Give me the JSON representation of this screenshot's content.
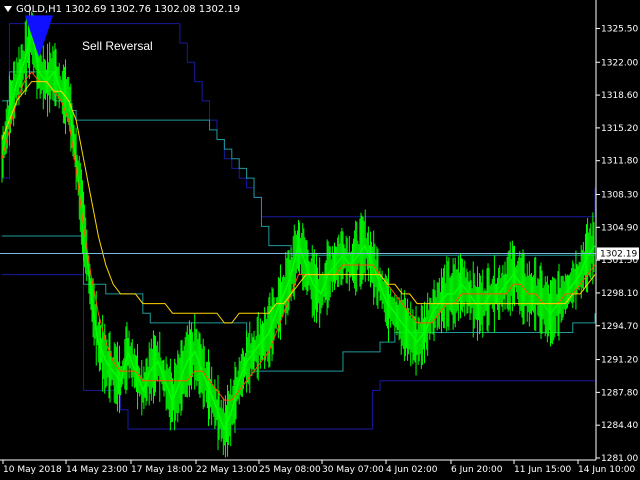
{
  "header": {
    "symbol": "GOLD,H1",
    "open": "1302.69",
    "high": "1302.76",
    "low": "1302.08",
    "close": "1302.19"
  },
  "signal": {
    "label": "Sell Reversal",
    "color": "#1010ff"
  },
  "colors": {
    "background": "#000000",
    "price": "#00ff00",
    "ma_fast": "#ff4d00",
    "ma_slow": "#ffd700",
    "channel_outer": "#1a1aa0",
    "channel_inner": "#1f9a9a",
    "current_line": "#7fb7d6",
    "axis": "#ffffff"
  },
  "chart_data": {
    "type": "line",
    "title": "",
    "ylim": [
      1281,
      1327
    ],
    "y_ticks": [
      "1325.50",
      "1322.00",
      "1318.60",
      "1315.20",
      "1311.80",
      "1308.30",
      "1304.90",
      "1301.50",
      "1298.10",
      "1294.70",
      "1291.20",
      "1287.80",
      "1284.40",
      "1281.00"
    ],
    "x_ticks": [
      "10 May 2018",
      "14 May 23:00",
      "17 May 18:00",
      "22 May 13:00",
      "25 May 08:00",
      "30 May 07:00",
      "4 Jun 02:00",
      "6 Jun 20:00",
      "11 Jun 15:00",
      "14 Jun 10:00"
    ],
    "current_price": "1302.19",
    "series": [
      {
        "key": "price",
        "values": [
          1312,
          1317,
          1320,
          1322,
          1325,
          1321,
          1320,
          1321,
          1319,
          1318,
          1312,
          1305,
          1298,
          1293,
          1291,
          1290,
          1289,
          1292,
          1290,
          1288,
          1290,
          1291,
          1289,
          1287,
          1289,
          1291,
          1292,
          1290,
          1288,
          1286,
          1284,
          1286,
          1289,
          1291,
          1292,
          1293,
          1294,
          1296,
          1298,
          1300,
          1303,
          1301,
          1299,
          1298,
          1300,
          1301,
          1302,
          1301,
          1302,
          1303,
          1301,
          1299,
          1297,
          1296,
          1295,
          1294,
          1293,
          1294,
          1296,
          1297,
          1298,
          1298,
          1299,
          1298,
          1297,
          1297,
          1298,
          1298,
          1299,
          1300,
          1299,
          1298,
          1298,
          1297,
          1296,
          1297,
          1298,
          1299,
          1300,
          1302,
          1303
        ]
      },
      {
        "key": "ma_fast",
        "values": [
          1312,
          1315,
          1318,
          1320,
          1321,
          1320,
          1320,
          1319,
          1318,
          1316,
          1311,
          1305,
          1300,
          1296,
          1293,
          1291,
          1290,
          1290,
          1290,
          1289,
          1289,
          1289,
          1289,
          1289,
          1289,
          1289,
          1290,
          1290,
          1289,
          1288,
          1287,
          1287,
          1288,
          1289,
          1290,
          1291,
          1292,
          1294,
          1296,
          1298,
          1300,
          1300,
          1300,
          1300,
          1300,
          1300,
          1301,
          1301,
          1301,
          1301,
          1301,
          1300,
          1299,
          1298,
          1297,
          1296,
          1295,
          1295,
          1295,
          1296,
          1297,
          1297,
          1298,
          1298,
          1298,
          1298,
          1298,
          1298,
          1298,
          1299,
          1299,
          1298,
          1298,
          1297,
          1297,
          1297,
          1298,
          1298,
          1299,
          1300,
          1301
        ]
      },
      {
        "key": "ma_slow",
        "values": [
          1314,
          1316,
          1318,
          1319,
          1320,
          1320,
          1320,
          1319,
          1319,
          1318,
          1316,
          1312,
          1308,
          1304,
          1301,
          1299,
          1298,
          1298,
          1298,
          1297,
          1297,
          1297,
          1297,
          1296,
          1296,
          1296,
          1296,
          1296,
          1296,
          1296,
          1295,
          1295,
          1296,
          1296,
          1296,
          1296,
          1296,
          1297,
          1297,
          1298,
          1299,
          1300,
          1300,
          1300,
          1300,
          1300,
          1300,
          1300,
          1300,
          1300,
          1300,
          1300,
          1299,
          1299,
          1298,
          1298,
          1297,
          1297,
          1297,
          1297,
          1297,
          1297,
          1297,
          1297,
          1297,
          1297,
          1297,
          1297,
          1297,
          1297,
          1297,
          1297,
          1297,
          1297,
          1297,
          1297,
          1297,
          1298,
          1298,
          1299,
          1300
        ]
      }
    ],
    "channels": [
      {
        "key": "channel_outer",
        "values": [
          1310,
          1326,
          1326,
          1326,
          1326,
          1326,
          1326,
          1326,
          1326,
          1326,
          1326,
          1326,
          1326,
          1326,
          1326,
          1326,
          1326,
          1326,
          1326,
          1326,
          1326,
          1326,
          1326,
          1326,
          1324,
          1322,
          1320,
          1318,
          1316,
          1314,
          1312,
          1311,
          1310,
          1309,
          1308,
          1306,
          1306,
          1306,
          1306,
          1306,
          1306,
          1306,
          1306,
          1306,
          1306,
          1306,
          1306,
          1306,
          1306,
          1306,
          1306,
          1306,
          1306,
          1306,
          1306,
          1306,
          1306,
          1306,
          1306,
          1306,
          1306,
          1306,
          1306,
          1306,
          1306,
          1306,
          1306,
          1306,
          1306,
          1306,
          1306,
          1306,
          1306,
          1306,
          1306,
          1306,
          1306,
          1306,
          1306,
          1306,
          1309
        ]
      },
      {
        "key": "channel_outer",
        "values": [
          1300,
          1300,
          1300,
          1300,
          1300,
          1300,
          1300,
          1300,
          1300,
          1300,
          1300,
          1288,
          1288,
          1288,
          1288,
          1288,
          1286,
          1284,
          1284,
          1284,
          1284,
          1284,
          1284,
          1284,
          1284,
          1284,
          1284,
          1284,
          1284,
          1284,
          1284,
          1284,
          1284,
          1284,
          1284,
          1284,
          1284,
          1284,
          1284,
          1284,
          1284,
          1284,
          1284,
          1284,
          1284,
          1284,
          1284,
          1284,
          1284,
          1284,
          1288,
          1289,
          1289,
          1289,
          1289,
          1289,
          1289,
          1289,
          1289,
          1289,
          1289,
          1289,
          1289,
          1289,
          1289,
          1289,
          1289,
          1289,
          1289,
          1289,
          1289,
          1289,
          1289,
          1289,
          1289,
          1289,
          1289,
          1289,
          1289,
          1289,
          1289
        ]
      },
      {
        "key": "channel_inner",
        "values": [
          1318,
          1321,
          1321,
          1321,
          1321,
          1321,
          1321,
          1318,
          1318,
          1317,
          1316,
          1316,
          1316,
          1316,
          1316,
          1316,
          1316,
          1316,
          1316,
          1316,
          1316,
          1316,
          1316,
          1316,
          1316,
          1316,
          1316,
          1316,
          1315,
          1314,
          1313,
          1312,
          1311,
          1310,
          1308,
          1305,
          1303,
          1303,
          1303,
          1302,
          1302,
          1302,
          1302,
          1302,
          1302,
          1302,
          1302,
          1302,
          1302,
          1302,
          1302,
          1302,
          1302,
          1302,
          1302,
          1302,
          1302,
          1302,
          1302,
          1302,
          1302,
          1302,
          1302,
          1302,
          1302,
          1302,
          1302,
          1302,
          1302,
          1302,
          1302,
          1302,
          1302,
          1302,
          1302,
          1302,
          1302,
          1302,
          1302,
          1302,
          1302
        ]
      },
      {
        "key": "channel_inner",
        "values": [
          1304,
          1304,
          1304,
          1304,
          1304,
          1304,
          1304,
          1304,
          1304,
          1304,
          1304,
          1299,
          1299,
          1299,
          1298,
          1298,
          1298,
          1298,
          1298,
          1296,
          1295,
          1295,
          1295,
          1295,
          1295,
          1295,
          1295,
          1295,
          1295,
          1295,
          1295,
          1295,
          1295,
          1292,
          1290,
          1290,
          1290,
          1290,
          1290,
          1290,
          1290,
          1290,
          1290,
          1290,
          1290,
          1290,
          1292,
          1292,
          1292,
          1292,
          1292,
          1293,
          1293,
          1294,
          1294,
          1294,
          1294,
          1294,
          1294,
          1294,
          1294,
          1294,
          1294,
          1294,
          1294,
          1294,
          1294,
          1294,
          1294,
          1294,
          1294,
          1294,
          1294,
          1294,
          1294,
          1294,
          1294,
          1295,
          1295,
          1295,
          1296
        ]
      }
    ],
    "marker": {
      "type": "sell",
      "index": 5,
      "price": 1322.5
    }
  }
}
